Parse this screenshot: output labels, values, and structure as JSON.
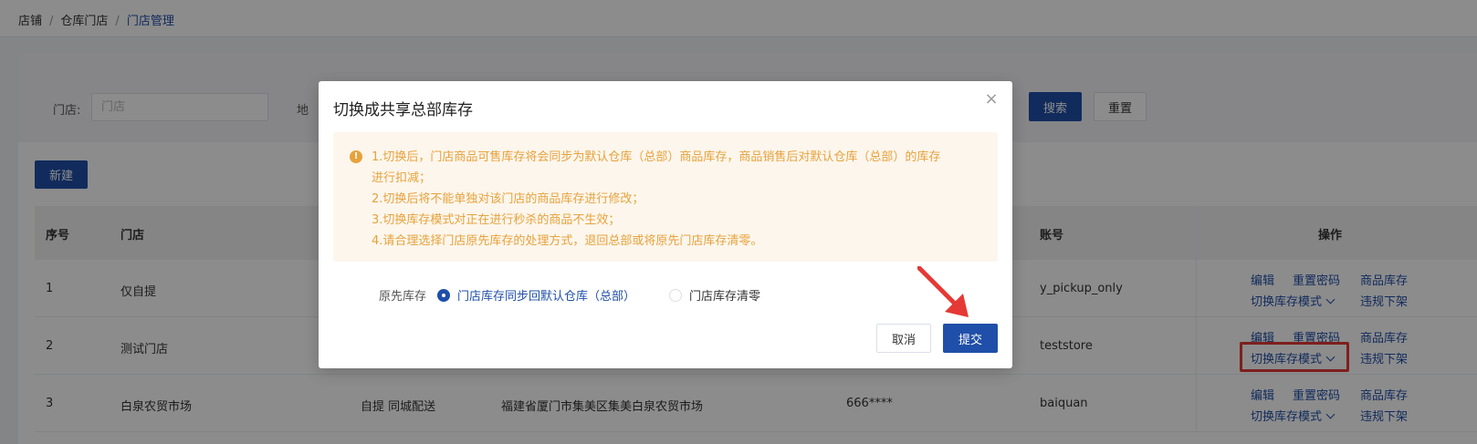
{
  "breadcrumb": {
    "items": [
      "店铺",
      "仓库门店"
    ],
    "current": "门店管理",
    "sep": "/"
  },
  "filter": {
    "store_label": "门店:",
    "store_placeholder": "门店",
    "region_label": "地",
    "search": "搜索",
    "reset": "重置"
  },
  "new_button": "新建",
  "table": {
    "headers": {
      "seq": "序号",
      "store": "门店",
      "account": "账号",
      "ops": "操作"
    },
    "rows": [
      {
        "seq": "1",
        "store": "仅自提",
        "delivery": "",
        "address": "",
        "phone": "",
        "account": "y_pickup_only"
      },
      {
        "seq": "2",
        "store": "测试门店",
        "delivery": "",
        "address": "",
        "phone": "",
        "account": "teststore"
      },
      {
        "seq": "3",
        "store": "白泉农贸市场",
        "delivery": "自提 同城配送",
        "address": "福建省厦门市集美区集美白泉农贸市场",
        "phone": "666****",
        "account": "baiquan"
      }
    ],
    "ops": {
      "edit": "编辑",
      "reset_pw": "重置密码",
      "stock": "商品库存",
      "switch_mode": "切换库存模式",
      "violation": "违规下架"
    }
  },
  "dialog": {
    "title": "切换成共享总部库存",
    "close": "×",
    "alert_icon": "!",
    "alert_lines": [
      "1.切换后，门店商品可售库存将会同步为默认仓库（总部）商品库存，商品销售后对默认仓库（总部）的库存",
      "进行扣减；",
      "2.切换后将不能单独对该门店的商品库存进行修改；",
      "3.切换库存模式对正在进行秒杀的商品不生效；",
      "4.请合理选择门店原先库存的处理方式，退回总部或将原先门店库存清零。"
    ],
    "radio_label": "原先库存",
    "option_sync": "门店库存同步回默认仓库（总部）",
    "option_clear": "门店库存清零",
    "cancel": "取消",
    "submit": "提交"
  },
  "colors": {
    "primary": "#1f4fa8",
    "warning": "#e6a23c",
    "highlight": "#e53935"
  }
}
